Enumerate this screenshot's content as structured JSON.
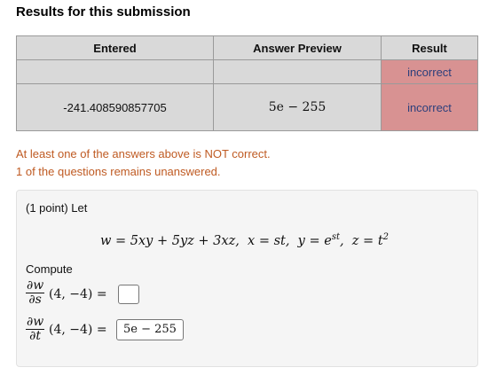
{
  "page": {
    "title": "Results for this submission"
  },
  "results_table": {
    "headers": [
      "Entered",
      "Answer Preview",
      "Result"
    ],
    "rows": [
      {
        "entered": "",
        "preview": "",
        "result": "incorrect"
      },
      {
        "entered": "-241.408590857705",
        "preview": "5e − 255",
        "result": "incorrect"
      }
    ]
  },
  "messages": {
    "not_correct": "At least one of the answers above is NOT correct.",
    "unanswered": "1 of the questions remains unanswered."
  },
  "problem": {
    "header": "(1 point) Let",
    "formula": "w = 5xy + 5yz + 3xz,  x = st,  y = e^{st},  z = t²",
    "compute": "Compute",
    "part1": {
      "numerator": "∂w",
      "denominator": "∂s",
      "args": "(4, −4) =",
      "answer": ""
    },
    "part2": {
      "numerator": "∂w",
      "denominator": "∂t",
      "args": "(4, −4) =",
      "answer": "5e − 255"
    }
  },
  "colors": {
    "header_cell": "#d9d9d9",
    "incorrect_cell": "#d89292",
    "incorrect_text": "#2c3f7c",
    "message_text": "#bf5a22",
    "problem_bg": "#f5f5f5"
  }
}
